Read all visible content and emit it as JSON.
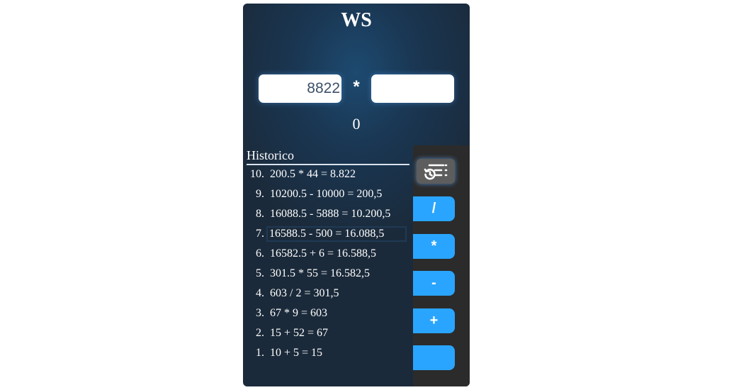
{
  "app": {
    "title": "WS",
    "operand_a": "8822",
    "operand_b": "",
    "operator": "*",
    "result": "0"
  },
  "history": {
    "title": "Historico",
    "items": [
      {
        "index": "10.",
        "text": "200.5 * 44 = 8.822"
      },
      {
        "index": "9.",
        "text": "10200.5 - 10000 = 200,5"
      },
      {
        "index": "8.",
        "text": "16088.5 - 5888 = 10.200,5"
      },
      {
        "index": "7.",
        "text": "16588.5 - 500 = 16.088,5"
      },
      {
        "index": "6.",
        "text": "16582.5 + 6 = 16.588,5"
      },
      {
        "index": "5.",
        "text": "301.5 * 55 = 16.582,5"
      },
      {
        "index": "4.",
        "text": "603 / 2 = 301,5"
      },
      {
        "index": "3.",
        "text": "67 * 9 = 603"
      },
      {
        "index": "2.",
        "text": "15 + 52 = 67"
      },
      {
        "index": "1.",
        "text": "10 + 5 = 15"
      }
    ]
  },
  "operations": {
    "divide": "/",
    "multiply": "*",
    "subtract": "-",
    "add": "+",
    "equals": ""
  },
  "icons": {
    "history_toggle": "history-list-icon"
  },
  "colors": {
    "accent": "#2aa5ff",
    "side_panel": "#2b2b2b",
    "toggle_bg": "#5d5d5d"
  }
}
